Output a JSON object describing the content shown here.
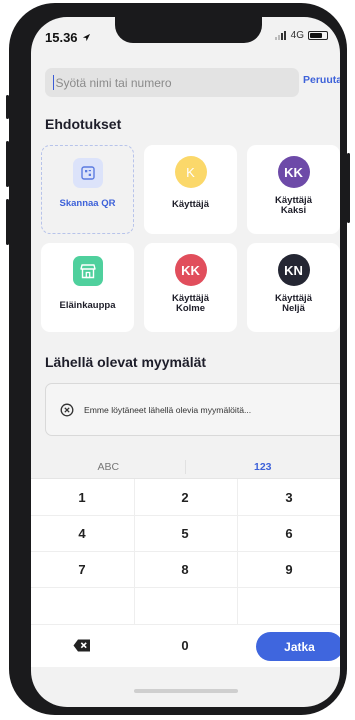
{
  "status_bar": {
    "time": "15.36",
    "network": "4G"
  },
  "search": {
    "placeholder": "Syötä nimi tai numero",
    "value": "",
    "cancel_label": "Peruuta"
  },
  "suggestions": {
    "title": "Ehdotukset",
    "items": [
      {
        "type": "action",
        "label": "Skannaa QR",
        "icon": "qr-scan-icon"
      },
      {
        "type": "contact",
        "initials": "K",
        "label": "Käyttäjä",
        "color": "#fbd86a"
      },
      {
        "type": "contact",
        "initials": "KK",
        "label": "Käyttäjä Kaksi",
        "color": "#6d4aa8"
      },
      {
        "type": "store",
        "label": "Eläinkauppa",
        "icon": "store-icon",
        "color": "#4fd09d"
      },
      {
        "type": "contact",
        "initials": "KK",
        "label": "Käyttäjä Kolme",
        "color": "#e14e5c"
      },
      {
        "type": "contact",
        "initials": "KN",
        "label": "Käyttäjä Neljä",
        "color": "#242633"
      }
    ]
  },
  "nearby": {
    "title": "Lähellä olevat myymälät",
    "empty_message": "Emme löytäneet lähellä olevia myymälöitä..."
  },
  "keyboard": {
    "tabs": [
      "ABC",
      "123"
    ],
    "active_tab": "123",
    "keys": [
      "1",
      "2",
      "3",
      "4",
      "5",
      "6",
      "7",
      "8",
      "9",
      "0"
    ],
    "submit_label": "Jatka"
  },
  "colors": {
    "accent": "#3f66de",
    "qr_tint": "#dce3fa",
    "background": "#f2f2f2"
  }
}
